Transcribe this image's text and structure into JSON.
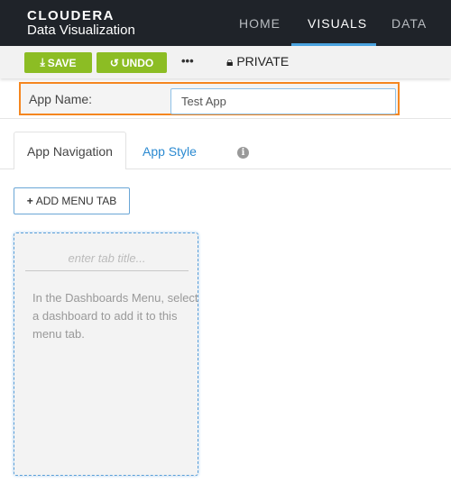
{
  "header": {
    "brand": "CLOUDERA",
    "product": "Data Visualization",
    "nav": [
      "HOME",
      "VISUALS",
      "DATA"
    ],
    "active_nav": "VISUALS"
  },
  "toolbar": {
    "save": "SAVE",
    "undo": "UNDO",
    "more": "•••",
    "private": "PRIVATE",
    "accent": "#8cbd24"
  },
  "app_name": {
    "label": "App Name:",
    "value": "Test App",
    "highlight": "#f5861f"
  },
  "tabs": {
    "items": [
      "App Navigation",
      "App Style"
    ],
    "active": "App Navigation",
    "info_icon": "info-circle-icon"
  },
  "add_menu_tab": "ADD MENU TAB",
  "menu_tab": {
    "title_placeholder": "enter tab title...",
    "hint": "In the Dashboards Menu, select a dashboard to add it to this menu tab."
  }
}
